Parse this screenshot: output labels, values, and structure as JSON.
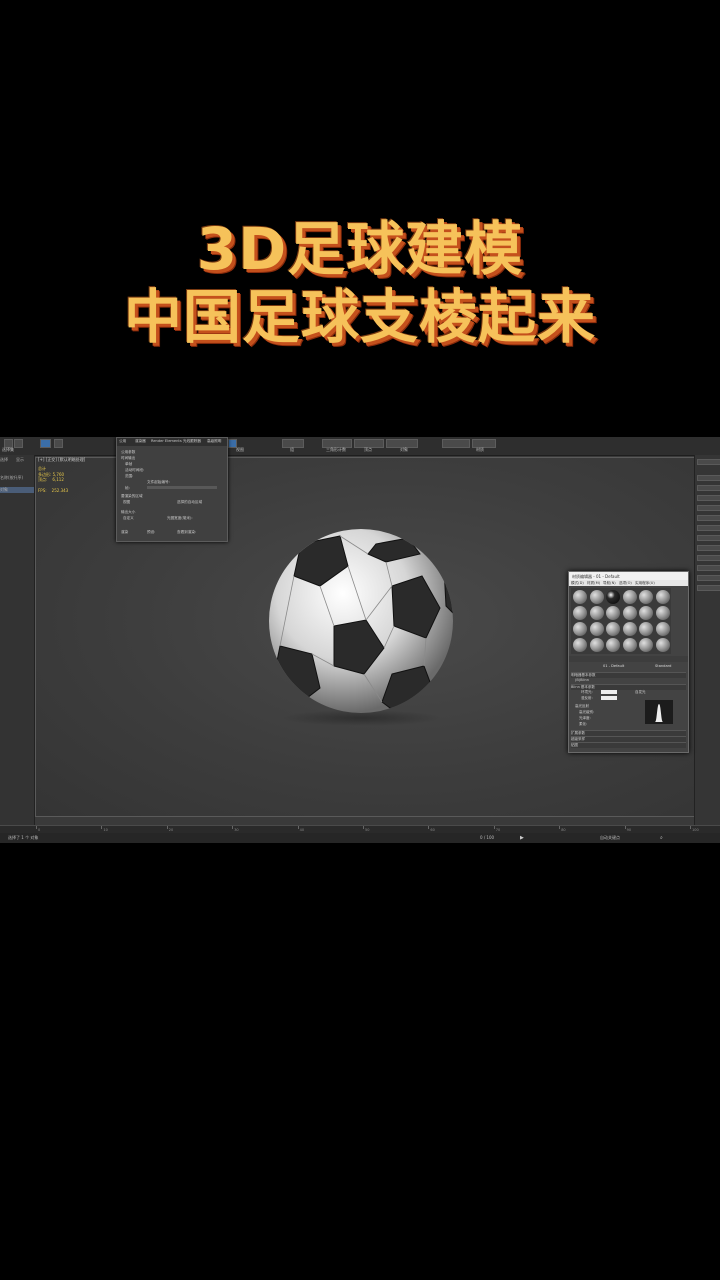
{
  "headline": {
    "line1": "3D足球建模",
    "line2": "中国足球支棱起来"
  },
  "app": {
    "toolbar_labels": [
      "选择集",
      "视图",
      "组",
      "三角形计数",
      "顶点",
      "对象",
      "材质"
    ],
    "left_panel": {
      "tab_select": "选择",
      "tab_display": "显示",
      "rows": [
        "名称(按升序)",
        "对象"
      ]
    },
    "viewport": {
      "label": "[+] [正交] [默认明暗处理]",
      "stats": "总计\n多边形: 5,760\n顶点:    6,112\n\nFPS:    252.343"
    },
    "render_dialog": {
      "title": "渲染设置",
      "tabs": [
        "公用",
        "渲染器",
        "Render Elements",
        "光线跟踪器",
        "高级照明"
      ],
      "rows": [
        "公用参数",
        "时间输出",
        "单帧",
        "活动时间段:",
        "范围:",
        "文件起始编号:",
        "帧:",
        "要渲染的区域",
        "视图",
        "选择的自动区域",
        "输出大小",
        "自定义",
        "光圈宽度(毫米):",
        "渲染",
        "预设:",
        "查看到渲染:"
      ]
    },
    "material_editor": {
      "title": "材质编辑器 - 01 - Default",
      "menus": [
        "模式(D)",
        "材质(M)",
        "导航(N)",
        "选项(O)",
        "实用程序(U)"
      ],
      "material_name": "01 - Default",
      "material_type": "Standard",
      "rows": [
        "明暗器基本参数",
        "(B)Blinn",
        "Blinn 基本参数",
        "环境光:",
        "漫反射:",
        "自发光",
        "高光反射",
        "高光级别:",
        "光泽度:",
        "柔化:",
        "扩展参数",
        "超级采样",
        "贴图"
      ],
      "sphere_count": 24,
      "active_sphere": 2
    },
    "status": {
      "left": "选择了 1 个 对象",
      "right": "0 / 100",
      "frame_label": "自动关键点"
    },
    "timeline_ticks": [
      "0",
      "10",
      "20",
      "30",
      "40",
      "50",
      "60",
      "70",
      "80",
      "90",
      "100"
    ],
    "icons": [
      "select-icon",
      "move-icon",
      "rotate-icon",
      "scale-icon",
      "render-icon",
      "material-editor-icon",
      "play-icon",
      "zoom-icon"
    ]
  }
}
